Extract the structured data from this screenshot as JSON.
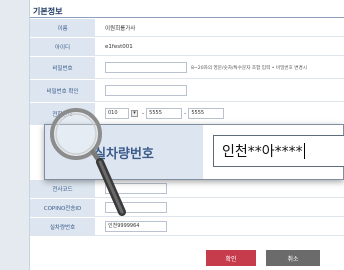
{
  "section": {
    "title": "기본정보"
  },
  "form": {
    "name": {
      "label": "이름",
      "value": "이원희를가사"
    },
    "userid": {
      "label": "아이디",
      "value": "e1fest001"
    },
    "password": {
      "label": "비밀번호",
      "hint": "8~20자의 영문/숫자/특수문자 조합 입력 • 비밀번호 변경시"
    },
    "password2": {
      "label": "비밀번호 확인"
    },
    "phone": {
      "label": "전화번호",
      "part1": "010",
      "part2": "5555",
      "part3": "5555"
    },
    "company_code": {
      "label": "전사코드"
    },
    "copino": {
      "label": "COPINO전송ID"
    },
    "vehicle": {
      "label": "실차량번호",
      "value": "인천9999964"
    }
  },
  "zoom": {
    "label": "실차량번호",
    "value": "인천**아****"
  },
  "buttons": {
    "confirm": "확인",
    "cancel": "취소"
  },
  "colors": {
    "accent_red": "#c63c4d",
    "header_blue": "#1e3a63",
    "label_bg": "#dde6f0"
  }
}
